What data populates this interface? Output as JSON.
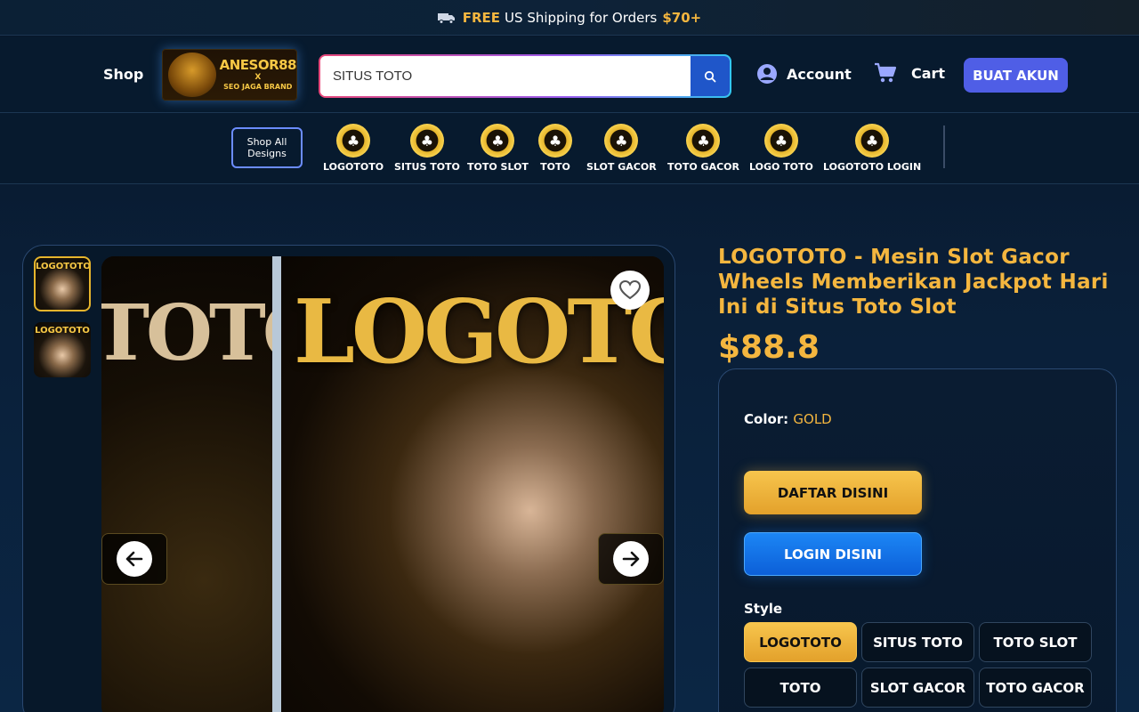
{
  "topbar": {
    "free": "FREE",
    "text": "US Shipping for Orders",
    "amount": "$70+",
    "icon": "truck-icon"
  },
  "header": {
    "shop": "Shop",
    "logo": {
      "line1": "ANESOR88",
      "line2": "X",
      "line3": "SEO JAGA BRAND"
    },
    "search_value": "SITUS TOTO",
    "account": "Account",
    "cart": "Cart",
    "signup": "BUAT AKUN"
  },
  "catnav": {
    "shop_all": "Shop All Designs",
    "items": [
      {
        "label": "LOGOTOTO"
      },
      {
        "label": "SITUS TOTO"
      },
      {
        "label": "TOTO SLOT"
      },
      {
        "label": "TOTO"
      },
      {
        "label": "SLOT GACOR"
      },
      {
        "label": "TOTO GACOR"
      },
      {
        "label": "LOGO TOTO"
      },
      {
        "label": "LOGOTOTO LOGIN"
      }
    ]
  },
  "gallery": {
    "thumb_text": "LOGOTOTO",
    "left_word": "TOTO",
    "right_word": "LOGOTO"
  },
  "product": {
    "title": "LOGOTOTO - Mesin Slot Gacor Wheels Memberikan Jackpot Hari Ini di Situs Toto Slot",
    "price": "$88.8",
    "color_label": "Color:",
    "color_value": "GOLD",
    "daftar": "DAFTAR DISINI",
    "login": "LOGIN DISINI",
    "style_label": "Style",
    "styles": [
      "LOGOTOTO",
      "SITUS TOTO",
      "TOTO SLOT",
      "TOTO",
      "SLOT GACOR",
      "TOTO GACOR"
    ],
    "selected_style": "LOGOTOTO"
  },
  "colors": {
    "accent_gold": "#f4b63f",
    "primary_blue": "#4f5ee6",
    "login_blue": "#1c86f5",
    "background": "#071628"
  }
}
